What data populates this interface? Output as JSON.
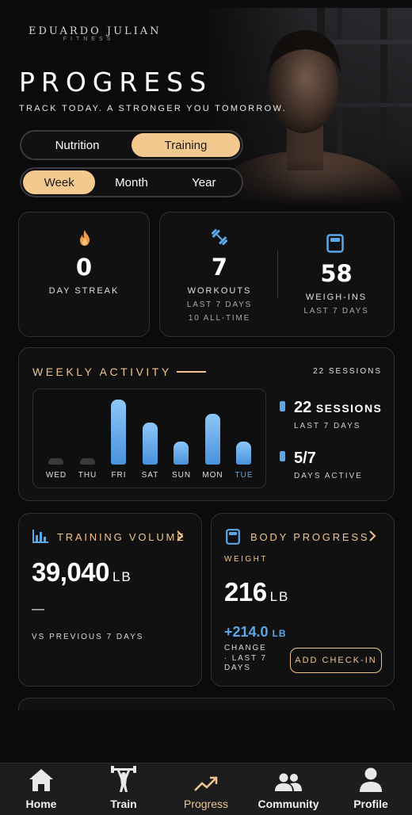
{
  "brand": {
    "logo_main": "EDUARDO JULIAN",
    "logo_sub": "FITNESS"
  },
  "header": {
    "title": "PROGRESS",
    "subtitle": "TRACK TODAY. A STRONGER YOU TOMORROW."
  },
  "mode_toggle": {
    "options": [
      "Nutrition",
      "Training"
    ],
    "selected": "Training"
  },
  "range_toggle": {
    "options": [
      "Week",
      "Month",
      "Year"
    ],
    "selected": "Week"
  },
  "streak": {
    "value": "0",
    "label": "DAY STREAK",
    "icon": "flame-icon"
  },
  "workouts": {
    "value": "7",
    "label": "WORKOUTS",
    "sub1": "LAST 7 DAYS",
    "sub2": "10 ALL-TIME",
    "icon": "dumbbell-icon"
  },
  "weighins": {
    "value": "58",
    "label": "WEIGH-INS",
    "sub": "LAST 7 DAYS",
    "icon": "scale-icon"
  },
  "weekly_activity": {
    "title": "WEEKLY ACTIVITY",
    "summary": "22 SESSIONS",
    "sessions_value": "22",
    "sessions_unit": "SESSIONS",
    "sessions_sub": "LAST 7 DAYS",
    "active_value": "5/7",
    "active_sub": "DAYS ACTIVE"
  },
  "chart_data": {
    "type": "bar",
    "categories": [
      "WED",
      "THU",
      "FRI",
      "SAT",
      "SUN",
      "MON",
      "TUE"
    ],
    "values": [
      0,
      0,
      7,
      4.5,
      2.5,
      5.5,
      2.5
    ],
    "highlight": "TUE",
    "ylim": [
      0,
      7
    ],
    "grid": false,
    "colors": {
      "bar": "#5aa7ea",
      "empty": "#3a3a3d",
      "highlight_label": "#5aa7ea"
    }
  },
  "training_volume": {
    "title": "TRAINING VOLUME",
    "value": "39,040",
    "unit": "LB",
    "change": "—",
    "compare": "VS PREVIOUS 7 DAYS"
  },
  "body_progress": {
    "title": "BODY PROGRESS",
    "metric": "WEIGHT",
    "value": "216",
    "unit": "LB",
    "change_value": "+214.0",
    "change_unit": "LB",
    "change_line1": "CHANGE",
    "change_line2": "· LAST 7",
    "change_line3": "DAYS",
    "button": "ADD CHECK-IN"
  },
  "nav": {
    "items": [
      {
        "label": "Home",
        "icon": "home-icon"
      },
      {
        "label": "Train",
        "icon": "weightlifter-icon"
      },
      {
        "label": "Progress",
        "icon": "trend-up-icon"
      },
      {
        "label": "Community",
        "icon": "people-icon"
      },
      {
        "label": "Profile",
        "icon": "person-icon"
      }
    ],
    "active": "Progress"
  },
  "colors": {
    "accent": "#f0c48c",
    "accent_fill": "#f3c990",
    "blue": "#5aa7ea",
    "background": "#0b0b0c",
    "card": "#111112"
  }
}
